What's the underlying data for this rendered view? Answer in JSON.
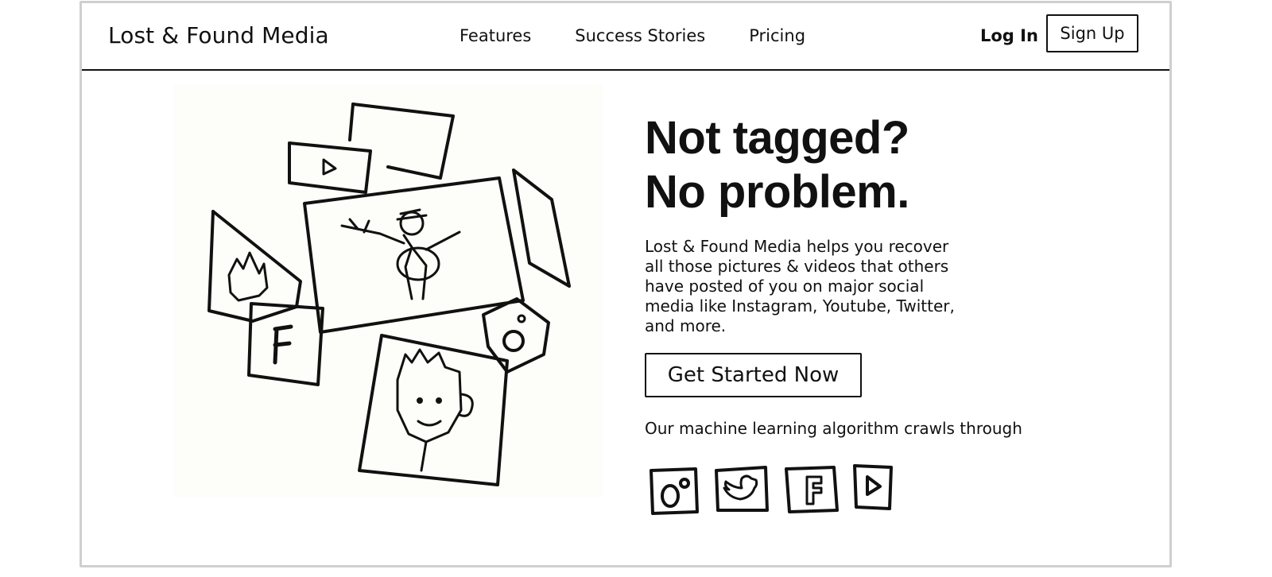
{
  "nav": {
    "brand": "Lost & Found Media",
    "links": [
      "Features",
      "Success Stories",
      "Pricing"
    ],
    "login": "Log In",
    "signup": "Sign Up"
  },
  "hero": {
    "illustration_icon": "sketch-collage-icon",
    "title_line1": "Not tagged?",
    "title_line2": "No problem.",
    "body": "Lost & Found Media helps you recover all those pictures & videos that others have posted of you on major social media like Instagram, Youtube, Twitter, and more.",
    "cta": "Get Started Now",
    "crawl_text": "Our machine learning algorithm crawls through",
    "platform_icons": [
      "instagram-icon",
      "twitter-icon",
      "facebook-icon",
      "youtube-icon"
    ]
  },
  "colors": {
    "ink": "#111111",
    "frame": "#cfcfcf",
    "background": "#ffffff"
  }
}
